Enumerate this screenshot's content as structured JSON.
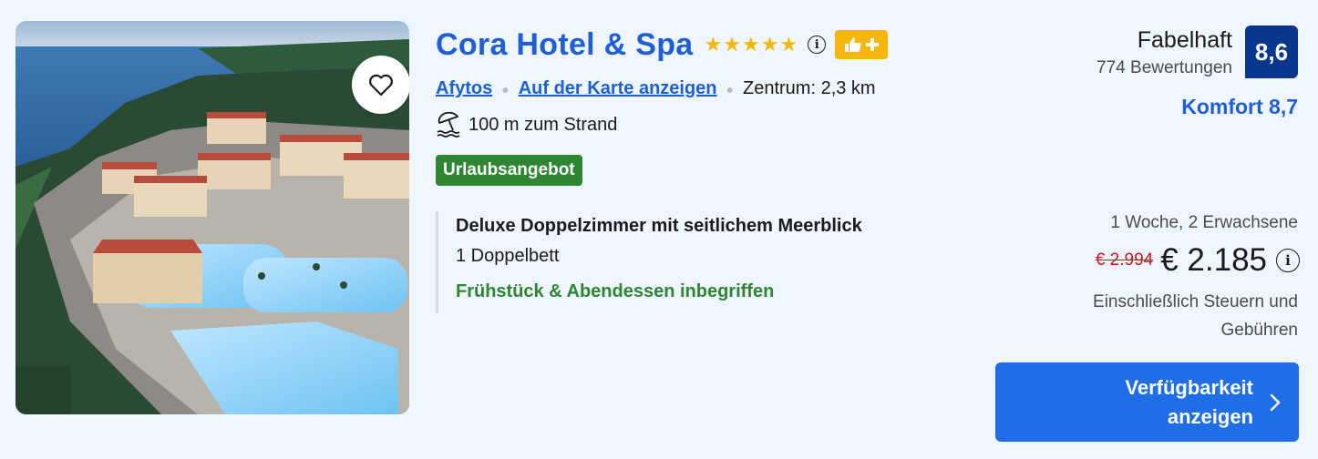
{
  "hotel": {
    "name": "Cora Hotel & Spa",
    "stars": 5,
    "location_link": "Afytos",
    "map_link": "Auf der Karte anzeigen",
    "center_distance": "Zentrum: 2,3 km",
    "beach_distance": "100 m zum Strand",
    "deal_badge": "Urlaubsangebot"
  },
  "room": {
    "name": "Deluxe Doppelzimmer mit seitlichem Meerblick",
    "beds": "1 Doppelbett",
    "meals": "Frühstück & Abendessen inbegriffen"
  },
  "review": {
    "label": "Fabelhaft",
    "count": "774 Bewertungen",
    "score": "8,6",
    "comfort": "Komfort 8,7"
  },
  "price": {
    "stay": "1 Woche, 2 Erwachsene",
    "old": "€ 2.994",
    "current": "€ 2.185",
    "tax_note": "Einschließlich Steuern und Gebühren"
  },
  "cta": {
    "label": "Verfügbarkeit anzeigen"
  },
  "colors": {
    "brand_blue": "#1f5fd6",
    "score_navy": "#0a3690",
    "deal_green": "#2e8532",
    "star_gold": "#f5b800",
    "strike_red": "#d4111e"
  },
  "icons": [
    "heart-icon",
    "star-icon",
    "info-icon",
    "thumbs-up-plus-icon",
    "beach-umbrella-icon",
    "chevron-right-icon"
  ]
}
